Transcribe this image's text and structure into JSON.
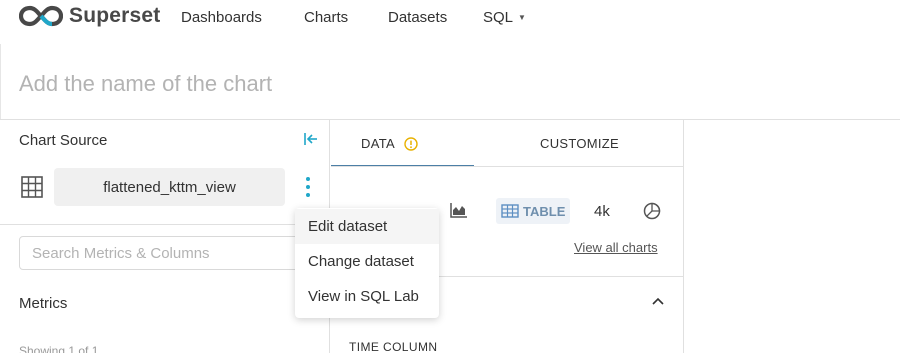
{
  "brand": {
    "name": "Superset"
  },
  "nav": {
    "items": [
      {
        "label": "Dashboards"
      },
      {
        "label": "Charts"
      },
      {
        "label": "Datasets"
      },
      {
        "label": "SQL"
      }
    ]
  },
  "chart": {
    "title_placeholder": "Add the name of the chart"
  },
  "left_panel": {
    "section_title": "Chart Source",
    "dataset_name": "flattened_kttm_view",
    "search_placeholder": "Search Metrics & Columns",
    "metrics_label": "Metrics",
    "showing_text": "Showing 1 of 1"
  },
  "dataset_menu": {
    "items": [
      {
        "label": "Edit dataset"
      },
      {
        "label": "Change dataset"
      },
      {
        "label": "View in SQL Lab"
      }
    ]
  },
  "mid_panel": {
    "tabs": [
      {
        "label": "DATA"
      },
      {
        "label": "CUSTOMIZE"
      }
    ],
    "viz_types": {
      "table_label": "TABLE",
      "big_number_label": "4k"
    },
    "view_all_link": "View all charts",
    "time_column_label": "TIME COLUMN"
  },
  "colors": {
    "accent": "#20a7c9",
    "warning": "#e8b100",
    "tab_underline": "#4c7fa6"
  },
  "icons": [
    "collapse-panel-icon",
    "dataset-grid-icon",
    "more-vertical-icon",
    "warning-circle-icon",
    "area-chart-icon",
    "table-icon",
    "pie-chart-icon",
    "chevron-up-icon"
  ]
}
